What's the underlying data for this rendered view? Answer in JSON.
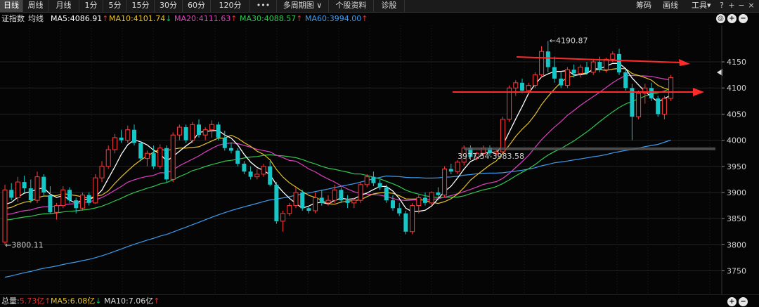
{
  "toolbar": {
    "tabs": [
      "日线",
      "周线",
      "月线",
      "1分",
      "5分",
      "15分",
      "30分",
      "60分",
      "120分",
      "•••",
      "多周期图 ∨",
      "个股资料",
      "诊股"
    ],
    "right_tools": [
      "筹码",
      "画线",
      "工具▾"
    ],
    "controls": [
      "?",
      "+",
      "−",
      "×"
    ]
  },
  "legend": {
    "index_label": "证指数",
    "avg_label": "均线",
    "ma5": {
      "text": "MA5:4086.91",
      "arrow": "↑",
      "color": "#ffffff"
    },
    "ma10": {
      "text": "MA10:4101.74",
      "arrow": "↓",
      "color": "#e6c229"
    },
    "ma20": {
      "text": "MA20:4111.63",
      "arrow": "↑",
      "color": "#e040c0"
    },
    "ma30": {
      "text": "MA30:4088.57",
      "arrow": "↑",
      "color": "#30c850"
    },
    "ma60": {
      "text": "MA60:3994.00",
      "arrow": "↑",
      "color": "#3c9cf0"
    },
    "right_controls": [
      "◎",
      "+",
      "−"
    ]
  },
  "volume": {
    "total": {
      "label": "总量:",
      "value": "5.73亿",
      "arrow": "↑"
    },
    "ma5": {
      "label": "MA5:",
      "value": "6.08亿",
      "arrow": "↓"
    },
    "ma10": {
      "label": "MA10:",
      "value": "7.06亿",
      "arrow": "↑"
    },
    "corner_controls": [
      "+",
      "−"
    ]
  },
  "chart_data": {
    "type": "candlestick",
    "y_ticks": [
      3750,
      3800,
      3850,
      3900,
      3950,
      4000,
      4050,
      4100,
      4150
    ],
    "y_range": [
      3705,
      4220
    ],
    "grid": true,
    "annotations": {
      "high": {
        "value": 4190.87,
        "text": "←4190.87"
      },
      "low": {
        "value": 3800.11,
        "text": "←3800.11"
      },
      "range_text": "3977.54-3983.58"
    },
    "candles": [
      [
        3805,
        3915,
        3800,
        3905
      ],
      [
        3905,
        3918,
        3885,
        3890
      ],
      [
        3890,
        3930,
        3882,
        3920
      ],
      [
        3920,
        3932,
        3900,
        3908
      ],
      [
        3908,
        3925,
        3880,
        3885
      ],
      [
        3885,
        3940,
        3880,
        3930
      ],
      [
        3930,
        3935,
        3895,
        3900
      ],
      [
        3895,
        3912,
        3860,
        3862
      ],
      [
        3862,
        3880,
        3848,
        3875
      ],
      [
        3875,
        3912,
        3870,
        3905
      ],
      [
        3905,
        3910,
        3880,
        3885
      ],
      [
        3885,
        3890,
        3860,
        3870
      ],
      [
        3870,
        3900,
        3865,
        3895
      ],
      [
        3895,
        3900,
        3875,
        3880
      ],
      [
        3880,
        3935,
        3878,
        3928
      ],
      [
        3928,
        3960,
        3920,
        3950
      ],
      [
        3950,
        3990,
        3945,
        3982
      ],
      [
        3982,
        4012,
        3975,
        4005
      ],
      [
        4005,
        4020,
        3995,
        4000
      ],
      [
        4000,
        4028,
        3995,
        4020
      ],
      [
        4020,
        4030,
        3990,
        3995
      ],
      [
        3995,
        3998,
        3960,
        3965
      ],
      [
        3965,
        3980,
        3950,
        3975
      ],
      [
        3975,
        3990,
        3945,
        3950
      ],
      [
        3950,
        3992,
        3945,
        3985
      ],
      [
        3985,
        3990,
        3920,
        3925
      ],
      [
        3925,
        4015,
        3920,
        4010
      ],
      [
        4010,
        4030,
        4000,
        4025
      ],
      [
        4025,
        4030,
        3995,
        4000
      ],
      [
        4000,
        4035,
        3995,
        4030
      ],
      [
        4030,
        4040,
        4005,
        4010
      ],
      [
        4010,
        4025,
        4000,
        4020
      ],
      [
        4020,
        4038,
        4005,
        4030
      ],
      [
        4030,
        4035,
        4000,
        4005
      ],
      [
        4005,
        4018,
        3980,
        3985
      ],
      [
        3985,
        3995,
        3975,
        3980
      ],
      [
        3980,
        3985,
        3950,
        3955
      ],
      [
        3955,
        3960,
        3935,
        3940
      ],
      [
        3940,
        3950,
        3925,
        3930
      ],
      [
        3930,
        3945,
        3925,
        3935
      ],
      [
        3935,
        3955,
        3930,
        3950
      ],
      [
        3950,
        3960,
        3912,
        3915
      ],
      [
        3915,
        3920,
        3840,
        3845
      ],
      [
        3845,
        3865,
        3825,
        3860
      ],
      [
        3860,
        3880,
        3855,
        3875
      ],
      [
        3875,
        3910,
        3870,
        3900
      ],
      [
        3900,
        3905,
        3865,
        3870
      ],
      [
        3870,
        3875,
        3860,
        3865
      ],
      [
        3865,
        3900,
        3860,
        3890
      ],
      [
        3890,
        3905,
        3875,
        3880
      ],
      [
        3880,
        3895,
        3875,
        3885
      ],
      [
        3885,
        3915,
        3880,
        3905
      ],
      [
        3905,
        3910,
        3880,
        3885
      ],
      [
        3885,
        3895,
        3870,
        3880
      ],
      [
        3880,
        3890,
        3870,
        3885
      ],
      [
        3885,
        3920,
        3880,
        3915
      ],
      [
        3915,
        3935,
        3910,
        3930
      ],
      [
        3930,
        3940,
        3912,
        3918
      ],
      [
        3918,
        3925,
        3905,
        3910
      ],
      [
        3910,
        3915,
        3880,
        3885
      ],
      [
        3885,
        3895,
        3865,
        3870
      ],
      [
        3870,
        3880,
        3855,
        3860
      ],
      [
        3860,
        3865,
        3820,
        3825
      ],
      [
        3825,
        3880,
        3820,
        3875
      ],
      [
        3875,
        3895,
        3860,
        3890
      ],
      [
        3890,
        3900,
        3875,
        3880
      ],
      [
        3880,
        3902,
        3875,
        3900
      ],
      [
        3900,
        3910,
        3885,
        3895
      ],
      [
        3895,
        3950,
        3890,
        3945
      ],
      [
        3945,
        3955,
        3935,
        3940
      ],
      [
        3940,
        3962,
        3935,
        3958
      ],
      [
        3958,
        3990,
        3952,
        3985
      ],
      [
        3985,
        3990,
        3962,
        3968
      ],
      [
        3968,
        3978,
        3962,
        3975
      ],
      [
        3975,
        3990,
        3965,
        3985
      ],
      [
        3985,
        3990,
        3970,
        3975
      ],
      [
        3975,
        3982,
        3970,
        3978
      ],
      [
        3978,
        4045,
        3975,
        4040
      ],
      [
        4040,
        4105,
        4035,
        4100
      ],
      [
        4100,
        4115,
        4085,
        4110
      ],
      [
        4110,
        4118,
        4090,
        4095
      ],
      [
        4095,
        4110,
        4088,
        4105
      ],
      [
        4105,
        4130,
        4100,
        4125
      ],
      [
        4125,
        4180,
        4120,
        4170
      ],
      [
        4170,
        4190,
        4130,
        4140
      ],
      [
        4140,
        4160,
        4110,
        4118
      ],
      [
        4118,
        4130,
        4100,
        4105
      ],
      [
        4105,
        4140,
        4100,
        4135
      ],
      [
        4135,
        4145,
        4120,
        4128
      ],
      [
        4128,
        4145,
        4120,
        4140
      ],
      [
        4140,
        4150,
        4125,
        4130
      ],
      [
        4130,
        4155,
        4125,
        4150
      ],
      [
        4150,
        4160,
        4130,
        4135
      ],
      [
        4135,
        4158,
        4130,
        4155
      ],
      [
        4155,
        4170,
        4150,
        4165
      ],
      [
        4165,
        4175,
        4125,
        4130
      ],
      [
        4130,
        4135,
        4095,
        4100
      ],
      [
        4100,
        4108,
        4000,
        4045
      ],
      [
        4045,
        4095,
        4040,
        4090
      ],
      [
        4090,
        4108,
        4070,
        4100
      ],
      [
        4100,
        4110,
        4075,
        4080
      ],
      [
        4080,
        4085,
        4045,
        4050
      ],
      [
        4050,
        4085,
        4040,
        4080
      ],
      [
        4080,
        4125,
        4075,
        4120
      ]
    ]
  }
}
